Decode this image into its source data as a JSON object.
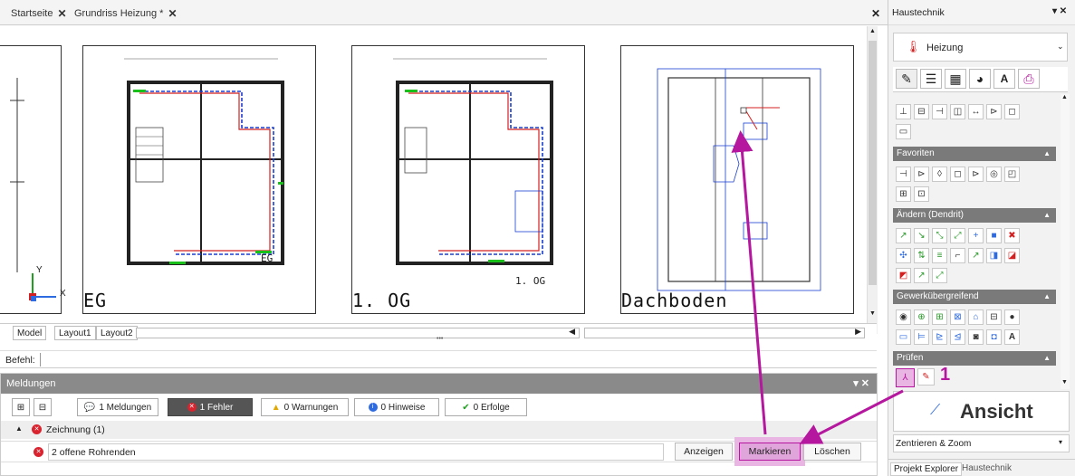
{
  "tabs": [
    {
      "label": "Startseite",
      "close": "✕"
    },
    {
      "label": "Grundriss Heizung *",
      "close": "✕"
    }
  ],
  "tabbar_close": "✕",
  "sheets": [
    {
      "label": "EG",
      "small_label": "EG"
    },
    {
      "label": "1. OG",
      "small_label": "1. OG"
    },
    {
      "label": "Dachboden"
    }
  ],
  "axis": {
    "x": "X",
    "y": "Y"
  },
  "layout_tabs": [
    "Model",
    "Layout1",
    "Layout2"
  ],
  "layout_dots": "•••",
  "command": {
    "label": "Befehl:",
    "value": ""
  },
  "messages": {
    "title": "Meldungen",
    "header_controls": "▾ ✕",
    "filters": [
      {
        "label": "1 Meldungen",
        "icon": "speech-icon"
      },
      {
        "label": "1 Fehler",
        "icon": "error-icon",
        "active": true
      },
      {
        "label": "0 Warnungen",
        "icon": "warning-icon"
      },
      {
        "label": "0 Hinweise",
        "icon": "info-icon"
      },
      {
        "label": "0 Erfolge",
        "icon": "check-icon"
      }
    ],
    "group": "Zeichnung (1)",
    "row": "2 offene Rohrenden",
    "actions": {
      "show": "Anzeigen",
      "mark": "Markieren",
      "delete": "Löschen"
    }
  },
  "right": {
    "title": "Haustechnik",
    "title_controls": "▾ ✕",
    "dropdown": "Heizung",
    "sections": [
      "Favoriten",
      "Ändern (Dendrit)",
      "Gewerkübergreifend",
      "Prüfen"
    ],
    "badge": "1",
    "ansicht": "Ansicht",
    "zoom_select": "Zentrieren & Zoom",
    "bottom_tabs": [
      "Projekt Explorer",
      "Haustechnik"
    ]
  },
  "colors": {
    "accent": "#b5179e",
    "highlight": "#e9b6e3",
    "error": "#d9232e",
    "active_filter": "#555555"
  }
}
